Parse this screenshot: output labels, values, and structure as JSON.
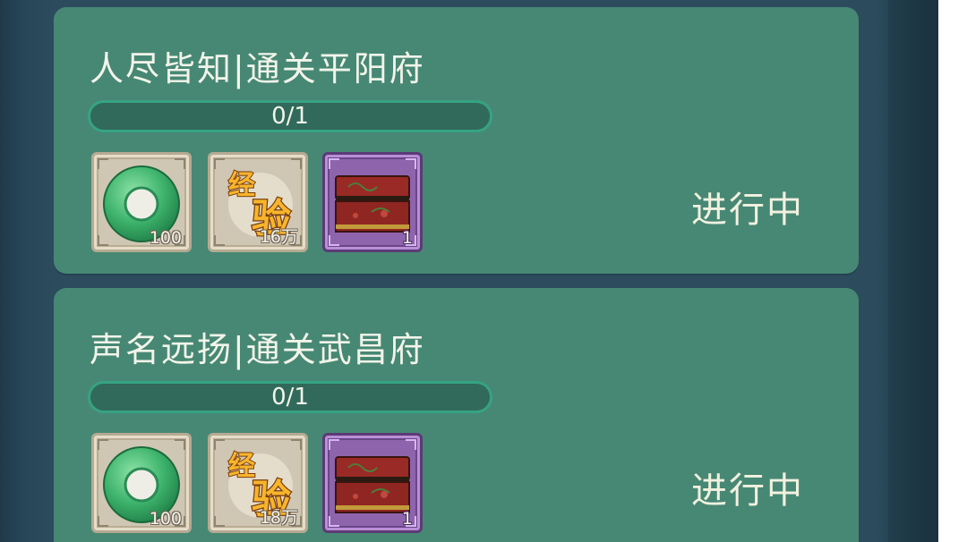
{
  "quests": [
    {
      "title": "人尽皆知|通关平阳府",
      "progress_text": "0/1",
      "progress_fraction": 0,
      "status": "进行中",
      "rewards": [
        {
          "icon": "jade-disc-icon",
          "count": "100"
        },
        {
          "icon": "experience-icon",
          "label_top": "经",
          "label_bottom": "验",
          "count": "16万"
        },
        {
          "icon": "treasure-chest-icon",
          "count": "1"
        }
      ]
    },
    {
      "title": "声名远扬|通关武昌府",
      "progress_text": "0/1",
      "progress_fraction": 0,
      "status": "进行中",
      "rewards": [
        {
          "icon": "jade-disc-icon",
          "count": "100"
        },
        {
          "icon": "experience-icon",
          "label_top": "经",
          "label_bottom": "验",
          "count": "18万"
        },
        {
          "icon": "treasure-chest-icon",
          "count": "1"
        }
      ]
    }
  ],
  "colors": {
    "card_background": "#478874",
    "progress_border": "#36a382",
    "panel_background": "#2c4c5e",
    "chest_frame": "#8e64ad"
  }
}
